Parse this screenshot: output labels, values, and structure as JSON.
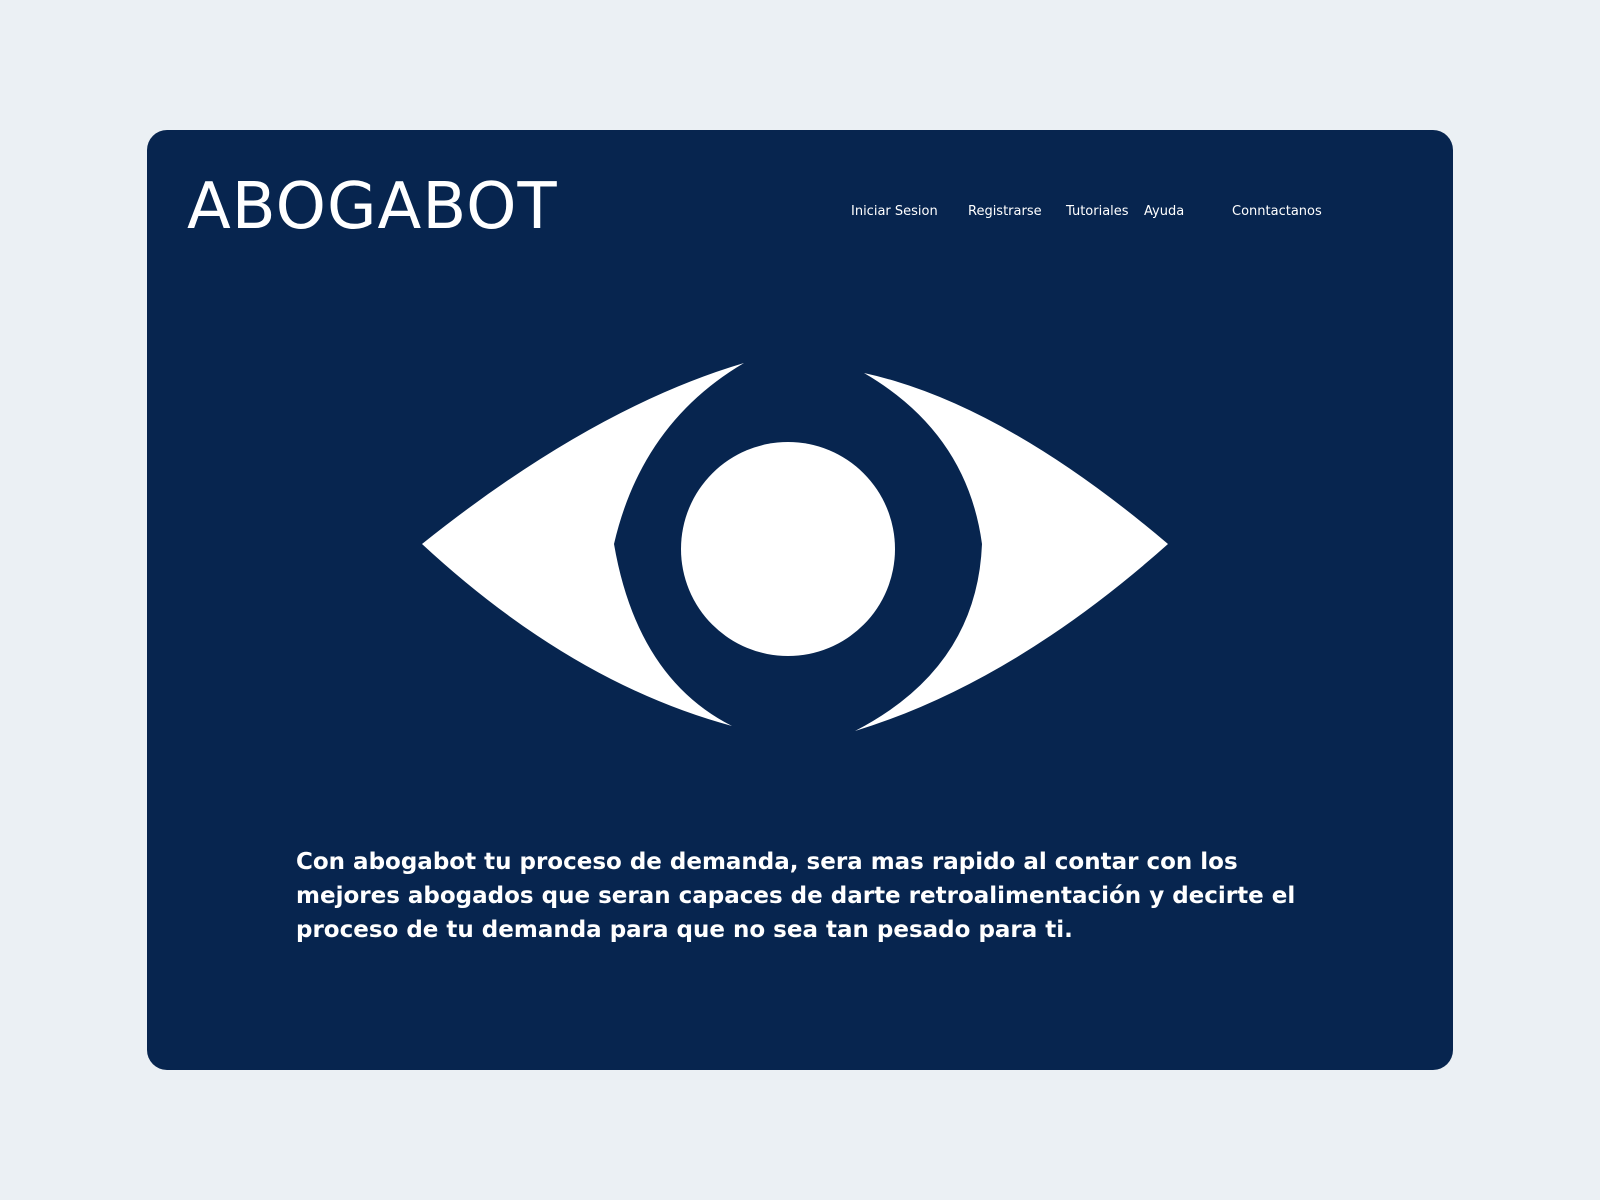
{
  "header": {
    "brand": "ABOGABOT"
  },
  "nav": {
    "items": [
      {
        "label": "Iniciar Sesion"
      },
      {
        "label": "Registrarse"
      },
      {
        "label": "Tutoriales"
      },
      {
        "label": "Ayuda"
      },
      {
        "label": "Conntactanos"
      }
    ]
  },
  "hero": {
    "icon": "eye-icon",
    "description": "Con abogabot tu proceso de demanda, sera mas rapido al contar  con los mejores abogados que seran capaces de darte retroalimentación y decirte el proceso de tu demanda para que no sea tan pesado para ti."
  },
  "colors": {
    "page_background": "#ebf0f4",
    "card_background": "#07254f",
    "text": "#ffffff"
  }
}
